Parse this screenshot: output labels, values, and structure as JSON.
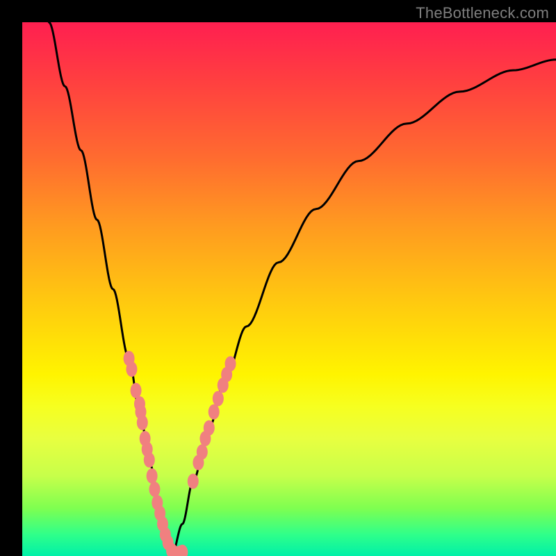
{
  "watermark": {
    "text": "TheBottleneck.com"
  },
  "chart_data": {
    "type": "line",
    "title": "",
    "xlabel": "",
    "ylabel": "",
    "xlim": [
      0,
      100
    ],
    "ylim": [
      0,
      100
    ],
    "grid": false,
    "legend": false,
    "note": "V-shaped bottleneck curve; y-axis reads as percentage mismatch (top=worst, bottom=best). Two curve branches meeting near x≈27 at y≈0.",
    "series": [
      {
        "name": "left-branch",
        "x": [
          5,
          8,
          11,
          14,
          17,
          20,
          22,
          24,
          26,
          27,
          28
        ],
        "values": [
          100,
          88,
          76,
          63,
          50,
          37,
          27,
          17,
          8,
          3,
          0
        ]
      },
      {
        "name": "right-branch",
        "x": [
          28,
          30,
          32,
          35,
          38,
          42,
          48,
          55,
          63,
          72,
          82,
          92,
          100
        ],
        "values": [
          0,
          6,
          14,
          24,
          33,
          43,
          55,
          65,
          74,
          81,
          87,
          91,
          93
        ]
      }
    ],
    "marker_clusters": [
      {
        "name": "left-cluster",
        "color": "#f08080",
        "points": [
          [
            20.0,
            37.0
          ],
          [
            20.5,
            35.0
          ],
          [
            21.3,
            31.0
          ],
          [
            22.0,
            28.5
          ],
          [
            22.2,
            27.0
          ],
          [
            22.5,
            25.0
          ],
          [
            23.0,
            22.0
          ],
          [
            23.4,
            20.0
          ],
          [
            23.8,
            18.0
          ],
          [
            24.3,
            15.0
          ],
          [
            24.8,
            12.5
          ],
          [
            25.3,
            10.0
          ],
          [
            25.8,
            8.0
          ],
          [
            26.3,
            6.0
          ],
          [
            26.8,
            4.0
          ],
          [
            27.3,
            2.5
          ],
          [
            28.0,
            1.0
          ],
          [
            28.6,
            0.5
          ],
          [
            29.5,
            0.5
          ],
          [
            30.0,
            0.7
          ]
        ]
      },
      {
        "name": "right-cluster",
        "color": "#f08080",
        "points": [
          [
            32.0,
            14.0
          ],
          [
            33.0,
            17.5
          ],
          [
            33.7,
            19.5
          ],
          [
            34.3,
            22.0
          ],
          [
            35.0,
            24.0
          ],
          [
            35.9,
            27.0
          ],
          [
            36.7,
            29.5
          ],
          [
            37.6,
            32.0
          ],
          [
            38.3,
            34.0
          ],
          [
            39.0,
            36.0
          ]
        ]
      }
    ],
    "colors": {
      "curve": "#000000",
      "marker_fill": "#f08080",
      "gradient_top": "#ff1f50",
      "gradient_mid": "#fff400",
      "gradient_bottom": "#00f0a8"
    }
  }
}
